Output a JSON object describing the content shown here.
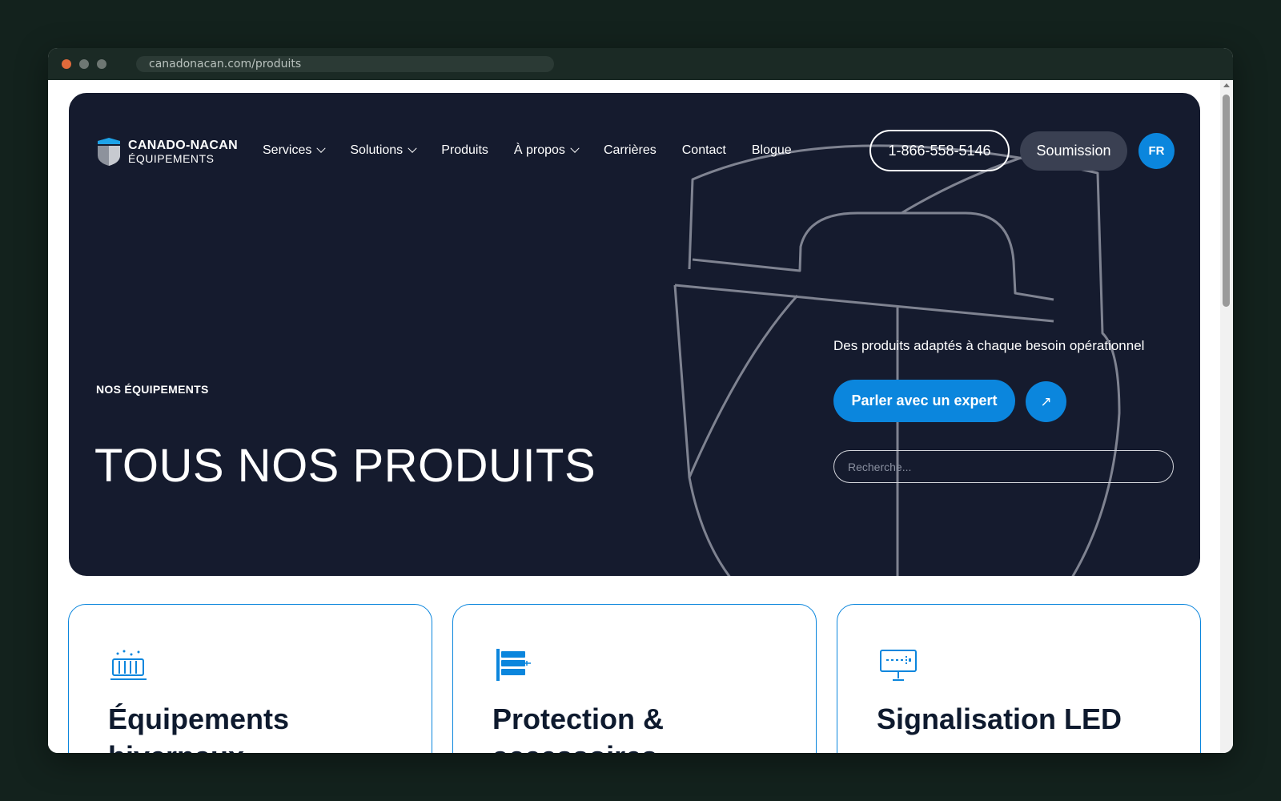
{
  "browser": {
    "url": "canadonacan.com/produits"
  },
  "header": {
    "logo": {
      "name": "CANADO-NACAN",
      "subtitle": "ÉQUIPEMENTS"
    },
    "nav": [
      {
        "label": "Services",
        "has_dropdown": true
      },
      {
        "label": "Solutions",
        "has_dropdown": true
      },
      {
        "label": "Produits",
        "has_dropdown": false
      },
      {
        "label": "À propos",
        "has_dropdown": true
      },
      {
        "label": "Carrières",
        "has_dropdown": false
      },
      {
        "label": "Contact",
        "has_dropdown": false
      },
      {
        "label": "Blogue",
        "has_dropdown": false
      }
    ],
    "phone": "1-866-558-5146",
    "quote_label": "Soumission",
    "lang_label": "FR"
  },
  "hero": {
    "eyebrow": "NOS ÉQUIPEMENTS",
    "title": "TOUS NOS PRODUITS",
    "tagline": "Des produits adaptés à chaque besoin opérationnel",
    "cta_label": "Parler avec un expert",
    "arrow_icon": "↗",
    "search_placeholder": "Recherche..."
  },
  "cards": [
    {
      "title": "Équipements hivernaux",
      "icon": "snow-plow-icon"
    },
    {
      "title": "Protection & accessoires",
      "icon": "barrier-icon"
    },
    {
      "title": "Signalisation LED",
      "icon": "led-sign-icon"
    }
  ],
  "colors": {
    "page_bg": "#13221d",
    "hero_bg": "#151b2e",
    "accent": "#0b86dd",
    "card_title": "#0e1a2e"
  }
}
